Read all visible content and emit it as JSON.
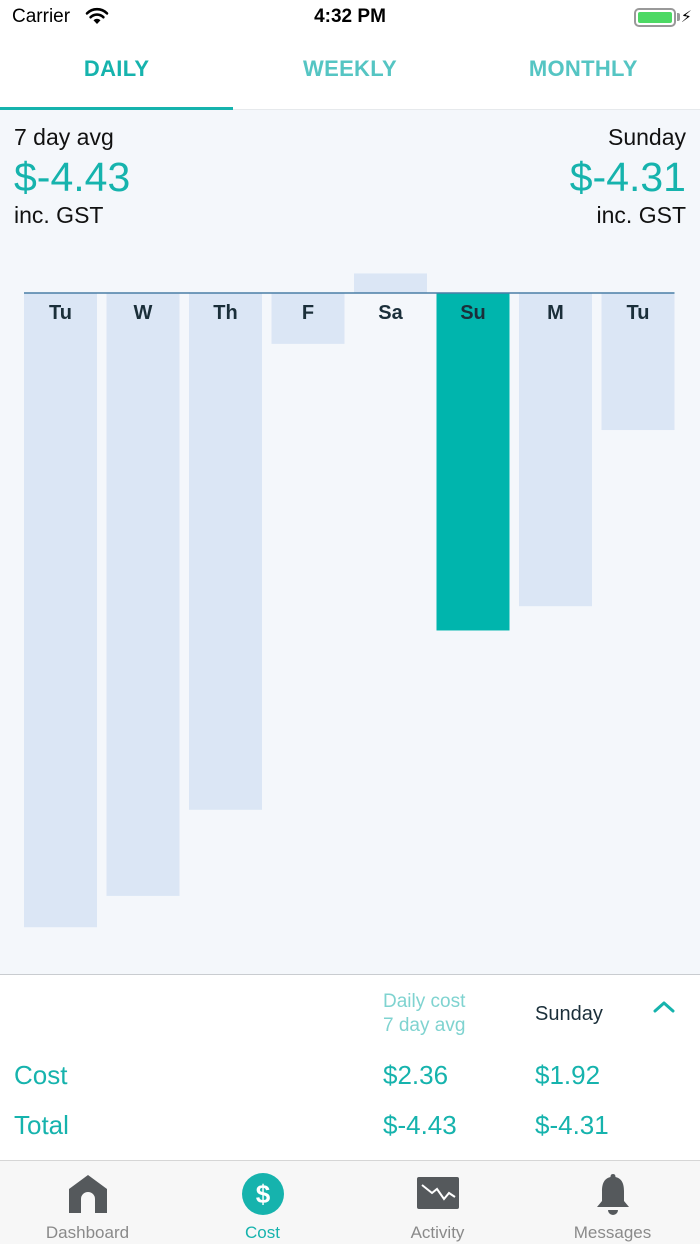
{
  "status_bar": {
    "carrier": "Carrier",
    "time": "4:32 PM"
  },
  "tabs": [
    {
      "label": "DAILY",
      "active": true
    },
    {
      "label": "WEEKLY",
      "active": false
    },
    {
      "label": "MONTHLY",
      "active": false
    }
  ],
  "header": {
    "avg_label": "7 day avg",
    "avg_value": "$-4.43",
    "avg_gst": "inc. GST",
    "selected_label": "Sunday",
    "selected_value": "$-4.31",
    "selected_gst": "inc. GST"
  },
  "chart_data": {
    "type": "bar",
    "categories": [
      "Tu",
      "W",
      "Th",
      "F",
      "Sa",
      "Su",
      "M",
      "Tu"
    ],
    "values": [
      -8.1,
      -7.7,
      -6.6,
      -0.65,
      0.25,
      -4.31,
      -4.0,
      -1.75
    ],
    "selected_index": 5,
    "ylim": [
      -8.5,
      0.5
    ],
    "colors": {
      "bar": "#dbe6f5",
      "selected": "#00b5ad",
      "baseline": "#4a7ea6",
      "label": "#1b2f3a"
    }
  },
  "summary": {
    "header_avg_line1": "Daily cost",
    "header_avg_line2": "7 day avg",
    "header_selected": "Sunday",
    "rows": [
      {
        "label": "Cost",
        "avg": "$2.36",
        "selected": "$1.92"
      },
      {
        "label": "Total",
        "avg": "$-4.43",
        "selected": "$-4.31"
      }
    ]
  },
  "bottom_nav": [
    {
      "label": "Dashboard",
      "icon": "home-icon",
      "active": false
    },
    {
      "label": "Cost",
      "icon": "dollar-icon",
      "active": true
    },
    {
      "label": "Activity",
      "icon": "activity-icon",
      "active": false
    },
    {
      "label": "Messages",
      "icon": "bell-icon",
      "active": false
    }
  ],
  "colors": {
    "accent": "#16b3ad",
    "accent_light": "#7fd3d0"
  }
}
